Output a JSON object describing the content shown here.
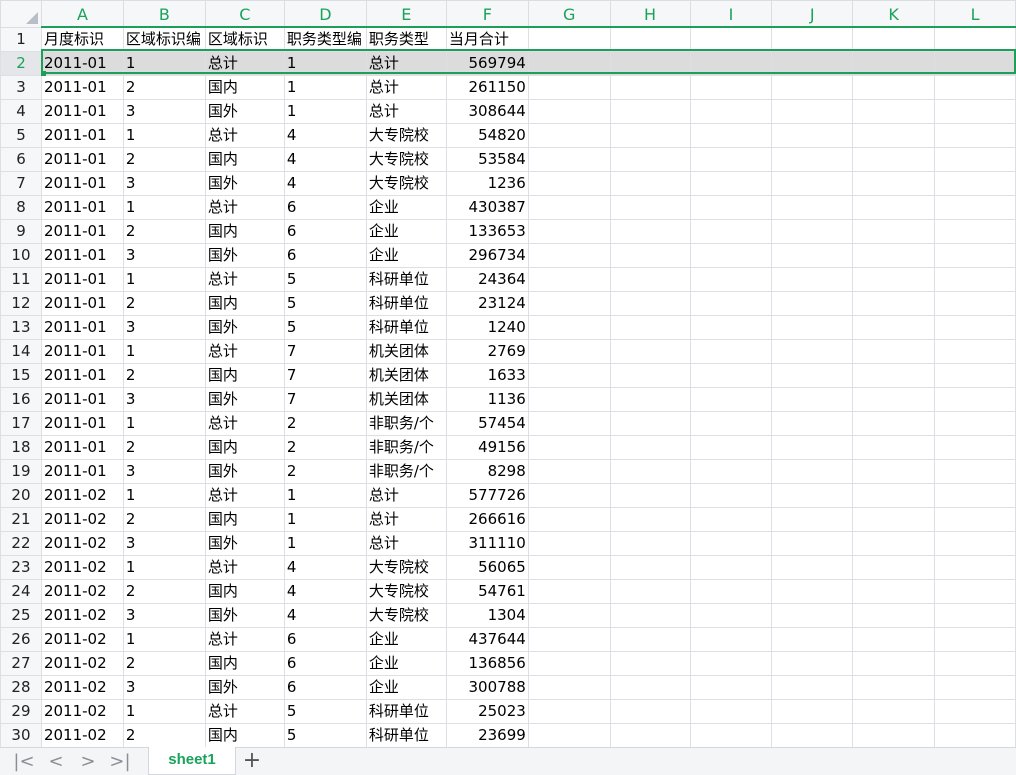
{
  "columns": [
    "A",
    "B",
    "C",
    "D",
    "E",
    "F",
    "G",
    "H",
    "I",
    "J",
    "K",
    "L"
  ],
  "rows": [
    {
      "n": "1",
      "cells": [
        "月度标识",
        "区域标识编",
        "区域标识",
        "职务类型编",
        "职务类型",
        "当月合计",
        "",
        "",
        "",
        "",
        "",
        ""
      ]
    },
    {
      "n": "2",
      "cells": [
        "2011-01",
        "1",
        "总计",
        "1",
        "总计",
        "569794",
        "",
        "",
        "",
        "",
        "",
        ""
      ]
    },
    {
      "n": "3",
      "cells": [
        "2011-01",
        "2",
        "国内",
        "1",
        "总计",
        "261150",
        "",
        "",
        "",
        "",
        "",
        ""
      ]
    },
    {
      "n": "4",
      "cells": [
        "2011-01",
        "3",
        "国外",
        "1",
        "总计",
        "308644",
        "",
        "",
        "",
        "",
        "",
        ""
      ]
    },
    {
      "n": "5",
      "cells": [
        "2011-01",
        "1",
        "总计",
        "4",
        "大专院校",
        "54820",
        "",
        "",
        "",
        "",
        "",
        ""
      ]
    },
    {
      "n": "6",
      "cells": [
        "2011-01",
        "2",
        "国内",
        "4",
        "大专院校",
        "53584",
        "",
        "",
        "",
        "",
        "",
        ""
      ]
    },
    {
      "n": "7",
      "cells": [
        "2011-01",
        "3",
        "国外",
        "4",
        "大专院校",
        "1236",
        "",
        "",
        "",
        "",
        "",
        ""
      ]
    },
    {
      "n": "8",
      "cells": [
        "2011-01",
        "1",
        "总计",
        "6",
        "企业",
        "430387",
        "",
        "",
        "",
        "",
        "",
        ""
      ]
    },
    {
      "n": "9",
      "cells": [
        "2011-01",
        "2",
        "国内",
        "6",
        "企业",
        "133653",
        "",
        "",
        "",
        "",
        "",
        ""
      ]
    },
    {
      "n": "10",
      "cells": [
        "2011-01",
        "3",
        "国外",
        "6",
        "企业",
        "296734",
        "",
        "",
        "",
        "",
        "",
        ""
      ]
    },
    {
      "n": "11",
      "cells": [
        "2011-01",
        "1",
        "总计",
        "5",
        "科研单位",
        "24364",
        "",
        "",
        "",
        "",
        "",
        ""
      ]
    },
    {
      "n": "12",
      "cells": [
        "2011-01",
        "2",
        "国内",
        "5",
        "科研单位",
        "23124",
        "",
        "",
        "",
        "",
        "",
        ""
      ]
    },
    {
      "n": "13",
      "cells": [
        "2011-01",
        "3",
        "国外",
        "5",
        "科研单位",
        "1240",
        "",
        "",
        "",
        "",
        "",
        ""
      ]
    },
    {
      "n": "14",
      "cells": [
        "2011-01",
        "1",
        "总计",
        "7",
        "机关团体",
        "2769",
        "",
        "",
        "",
        "",
        "",
        ""
      ]
    },
    {
      "n": "15",
      "cells": [
        "2011-01",
        "2",
        "国内",
        "7",
        "机关团体",
        "1633",
        "",
        "",
        "",
        "",
        "",
        ""
      ]
    },
    {
      "n": "16",
      "cells": [
        "2011-01",
        "3",
        "国外",
        "7",
        "机关团体",
        "1136",
        "",
        "",
        "",
        "",
        "",
        ""
      ]
    },
    {
      "n": "17",
      "cells": [
        "2011-01",
        "1",
        "总计",
        "2",
        "非职务/个",
        "57454",
        "",
        "",
        "",
        "",
        "",
        ""
      ]
    },
    {
      "n": "18",
      "cells": [
        "2011-01",
        "2",
        "国内",
        "2",
        "非职务/个",
        "49156",
        "",
        "",
        "",
        "",
        "",
        ""
      ]
    },
    {
      "n": "19",
      "cells": [
        "2011-01",
        "3",
        "国外",
        "2",
        "非职务/个",
        "8298",
        "",
        "",
        "",
        "",
        "",
        ""
      ]
    },
    {
      "n": "20",
      "cells": [
        "2011-02",
        "1",
        "总计",
        "1",
        "总计",
        "577726",
        "",
        "",
        "",
        "",
        "",
        ""
      ]
    },
    {
      "n": "21",
      "cells": [
        "2011-02",
        "2",
        "国内",
        "1",
        "总计",
        "266616",
        "",
        "",
        "",
        "",
        "",
        ""
      ]
    },
    {
      "n": "22",
      "cells": [
        "2011-02",
        "3",
        "国外",
        "1",
        "总计",
        "311110",
        "",
        "",
        "",
        "",
        "",
        ""
      ]
    },
    {
      "n": "23",
      "cells": [
        "2011-02",
        "1",
        "总计",
        "4",
        "大专院校",
        "56065",
        "",
        "",
        "",
        "",
        "",
        ""
      ]
    },
    {
      "n": "24",
      "cells": [
        "2011-02",
        "2",
        "国内",
        "4",
        "大专院校",
        "54761",
        "",
        "",
        "",
        "",
        "",
        ""
      ]
    },
    {
      "n": "25",
      "cells": [
        "2011-02",
        "3",
        "国外",
        "4",
        "大专院校",
        "1304",
        "",
        "",
        "",
        "",
        "",
        ""
      ]
    },
    {
      "n": "26",
      "cells": [
        "2011-02",
        "1",
        "总计",
        "6",
        "企业",
        "437644",
        "",
        "",
        "",
        "",
        "",
        ""
      ]
    },
    {
      "n": "27",
      "cells": [
        "2011-02",
        "2",
        "国内",
        "6",
        "企业",
        "136856",
        "",
        "",
        "",
        "",
        "",
        ""
      ]
    },
    {
      "n": "28",
      "cells": [
        "2011-02",
        "3",
        "国外",
        "6",
        "企业",
        "300788",
        "",
        "",
        "",
        "",
        "",
        ""
      ]
    },
    {
      "n": "29",
      "cells": [
        "2011-02",
        "1",
        "总计",
        "5",
        "科研单位",
        "25023",
        "",
        "",
        "",
        "",
        "",
        ""
      ]
    },
    {
      "n": "30",
      "cells": [
        "2011-02",
        "2",
        "国内",
        "5",
        "科研单位",
        "23699",
        "",
        "",
        "",
        "",
        "",
        ""
      ]
    }
  ],
  "selected_row": "2",
  "sheet_bar": {
    "nav": [
      {
        "icon": "first-sheet-icon",
        "glyph": "|<"
      },
      {
        "icon": "prev-sheet-icon",
        "glyph": "<"
      },
      {
        "icon": "next-sheet-icon",
        "glyph": ">"
      },
      {
        "icon": "last-sheet-icon",
        "glyph": ">|"
      }
    ],
    "active_tab": "sheet1",
    "add_label": "+"
  },
  "colors": {
    "accent": "#1aa35a",
    "selection": "#1f9e5a",
    "selected_fill": "#dcdcdc"
  }
}
